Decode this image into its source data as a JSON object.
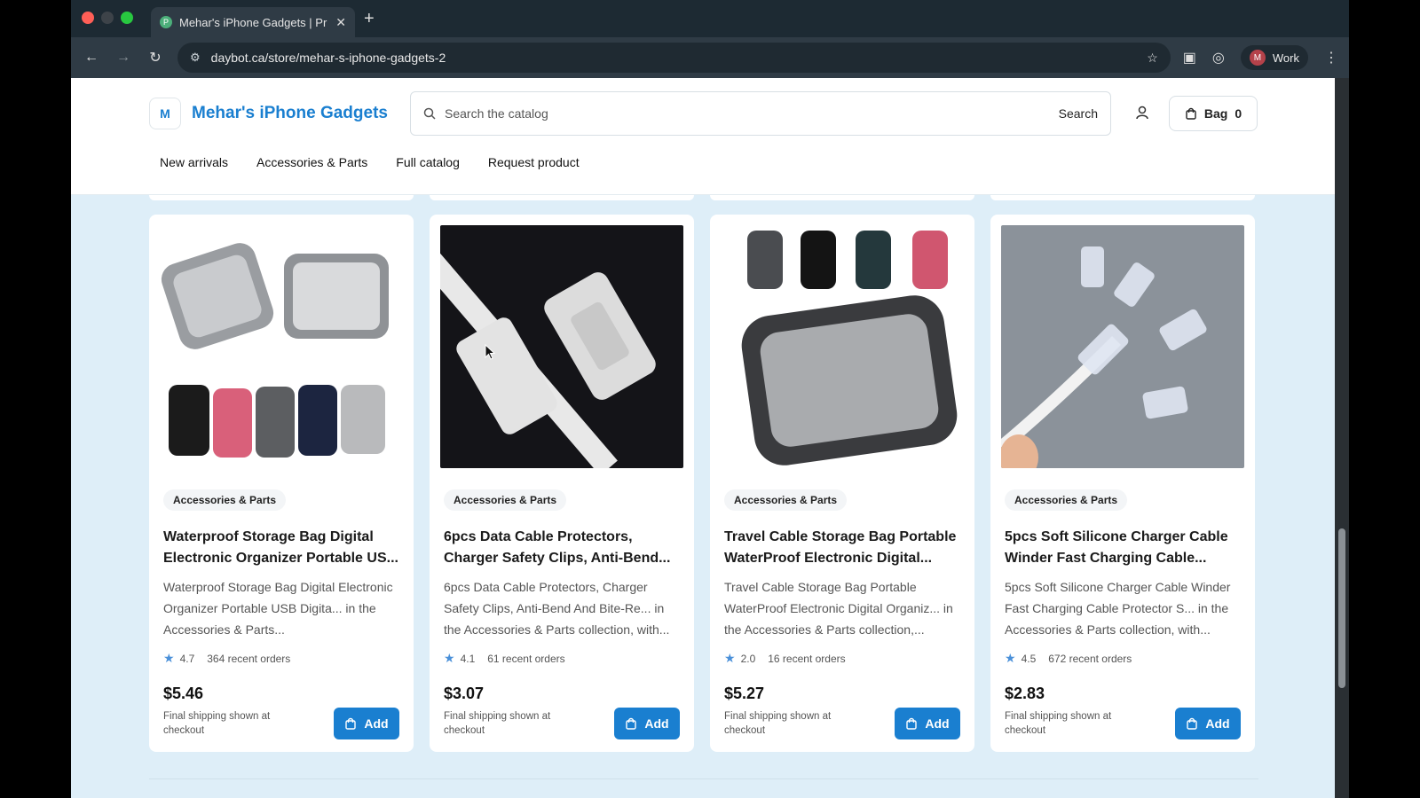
{
  "browser": {
    "tab_title": "Mehar's iPhone Gadgets | Pr",
    "tab_favicon_letter": "P",
    "url": "daybot.ca/store/mehar-s-iphone-gadgets-2",
    "profile_name": "Work",
    "profile_initial": "M"
  },
  "store": {
    "logo_letter": "M",
    "name": "Mehar's iPhone Gadgets",
    "search_placeholder": "Search the catalog",
    "search_button": "Search",
    "bag_label": "Bag",
    "bag_count": "0",
    "nav": [
      "New arrivals",
      "Accessories & Parts",
      "Full catalog",
      "Request product"
    ]
  },
  "products": [
    {
      "category": "Accessories & Parts",
      "title": "Waterproof Storage Bag Digital Electronic Organizer Portable US...",
      "description": "Waterproof Storage Bag Digital Electronic Organizer Portable USB Digita... in the Accessories & Parts...",
      "rating": "4.7",
      "orders": "364 recent orders",
      "price": "$5.46",
      "shipping": "Final shipping shown at checkout",
      "add_label": "Add"
    },
    {
      "category": "Accessories & Parts",
      "title": "6pcs Data Cable Protectors, Charger Safety Clips, Anti-Bend...",
      "description": "6pcs Data Cable Protectors, Charger Safety Clips, Anti-Bend And Bite-Re... in the Accessories & Parts collection, with...",
      "rating": "4.1",
      "orders": "61 recent orders",
      "price": "$3.07",
      "shipping": "Final shipping shown at checkout",
      "add_label": "Add"
    },
    {
      "category": "Accessories & Parts",
      "title": "Travel Cable Storage Bag Portable WaterProof Electronic Digital...",
      "description": "Travel Cable Storage Bag Portable WaterProof Electronic Digital Organiz... in the Accessories & Parts collection,...",
      "rating": "2.0",
      "orders": "16 recent orders",
      "price": "$5.27",
      "shipping": "Final shipping shown at checkout",
      "add_label": "Add"
    },
    {
      "category": "Accessories & Parts",
      "title": "5pcs Soft Silicone Charger Cable Winder Fast Charging Cable...",
      "description": "5pcs Soft Silicone Charger Cable Winder Fast Charging Cable Protector S... in the Accessories & Parts collection, with...",
      "rating": "4.5",
      "orders": "672 recent orders",
      "price": "$2.83",
      "shipping": "Final shipping shown at checkout",
      "add_label": "Add"
    }
  ],
  "colors": {
    "accent": "#1a7fd0",
    "page_background": "#deeef8"
  }
}
